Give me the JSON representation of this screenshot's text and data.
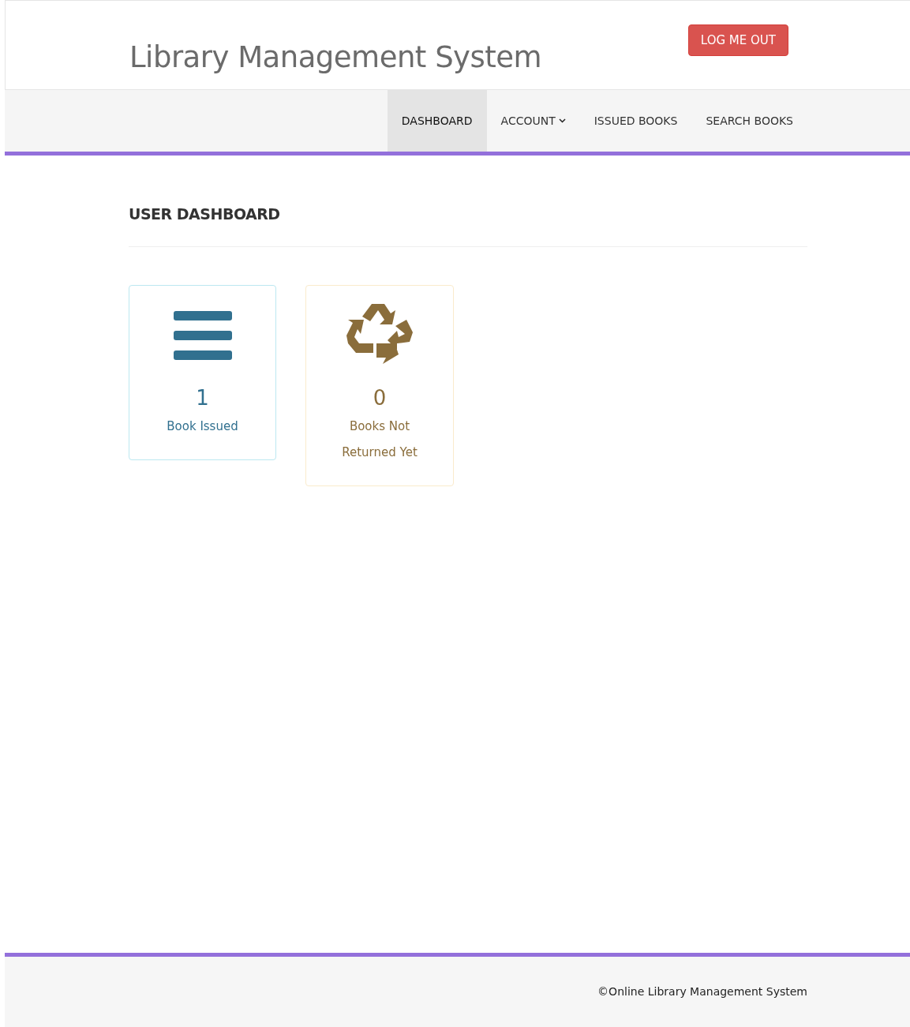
{
  "header": {
    "title": "Library Management System",
    "logout": "LOG ME OUT"
  },
  "nav": [
    {
      "label": "DASHBOARD",
      "selected": true,
      "dropdown": false
    },
    {
      "label": "ACCOUNT",
      "selected": false,
      "dropdown": true
    },
    {
      "label": "ISSUED BOOKS",
      "selected": false,
      "dropdown": false
    },
    {
      "label": "SEARCH BOOKS",
      "selected": false,
      "dropdown": false
    }
  ],
  "heading": "USER DASHBOARD",
  "cards": [
    {
      "kind": "info",
      "count": "1",
      "label": "Book Issued"
    },
    {
      "kind": "warning",
      "count": "0",
      "label": "Books Not Returned Yet"
    }
  ],
  "footer": "©Online Library Management System"
}
